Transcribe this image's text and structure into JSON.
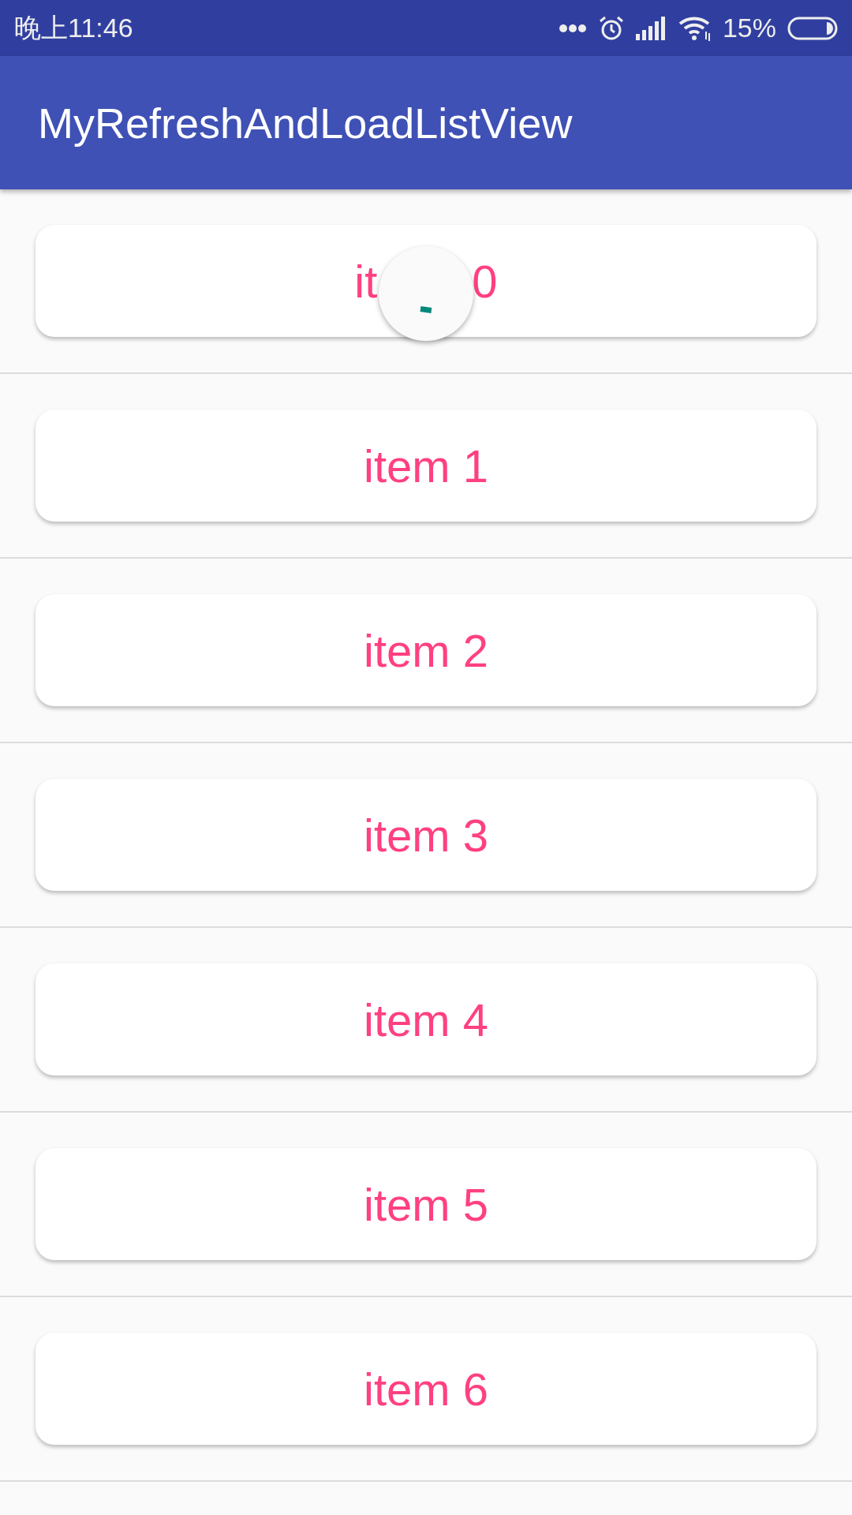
{
  "status_bar": {
    "time": "晚上11:46",
    "battery": "15%"
  },
  "app_bar": {
    "title": "MyRefreshAndLoadListView"
  },
  "refresh_indicator": {
    "visible": true
  },
  "list": [
    {
      "label_start": "it",
      "label_end": "0"
    },
    {
      "label": "item 1"
    },
    {
      "label": "item 2"
    },
    {
      "label": "item 3"
    },
    {
      "label": "item 4"
    },
    {
      "label": "item 5"
    },
    {
      "label": "item 6"
    }
  ]
}
